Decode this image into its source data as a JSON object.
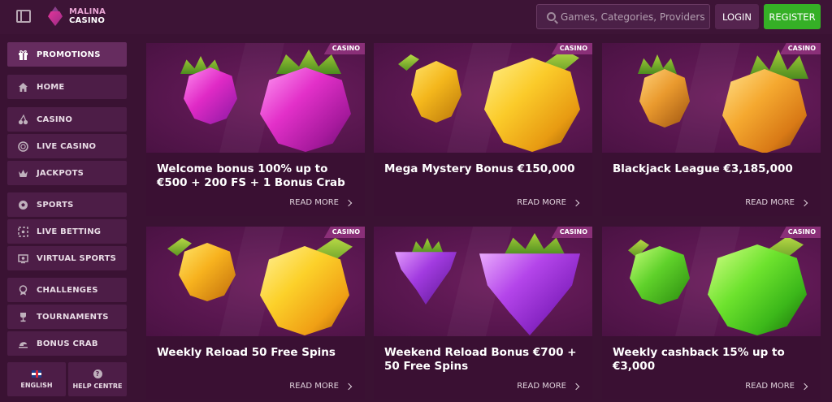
{
  "header": {
    "logo_line1": "MALINA",
    "logo_line2": "CASINO",
    "search_placeholder": "Games, Categories, Providers",
    "login_label": "LOGIN",
    "register_label": "REGISTER"
  },
  "sidebar": {
    "items": [
      {
        "label": "PROMOTIONS",
        "icon": "gift-icon"
      },
      {
        "label": "HOME",
        "icon": "home-icon"
      },
      {
        "label": "CASINO",
        "icon": "cherries-icon"
      },
      {
        "label": "LIVE CASINO",
        "icon": "chip-icon"
      },
      {
        "label": "JACKPOTS",
        "icon": "crown-icon"
      },
      {
        "label": "SPORTS",
        "icon": "ball-icon"
      },
      {
        "label": "LIVE BETTING",
        "icon": "live-icon"
      },
      {
        "label": "VIRTUAL SPORTS",
        "icon": "screen-icon"
      },
      {
        "label": "CHALLENGES",
        "icon": "badge-icon"
      },
      {
        "label": "TOURNAMENTS",
        "icon": "trophy-icon"
      },
      {
        "label": "BONUS CRAB",
        "icon": "crab-icon"
      }
    ],
    "language_label": "ENGLISH",
    "help_label": "HELP CENTRE"
  },
  "colors": {
    "background": "#3a1233",
    "register_green": "#35b026",
    "badge_purple": "#8a2f78"
  },
  "cards": [
    {
      "badge": "CASINO",
      "title": "Welcome bonus 100% up to €500 + 200 FS + 1 Bonus Crab",
      "read_more": "READ MORE",
      "fruit": "raspberry"
    },
    {
      "badge": "CASINO",
      "title": "Mega Mystery Bonus €150,000",
      "read_more": "READ MORE",
      "fruit": "pear"
    },
    {
      "badge": "CASINO",
      "title": "Blackjack League €3,185,000",
      "read_more": "READ MORE",
      "fruit": "pineapple"
    },
    {
      "badge": "CASINO",
      "title": "Weekly Reload 50 Free Spins",
      "read_more": "READ MORE",
      "fruit": "lemon"
    },
    {
      "badge": "CASINO",
      "title": "Weekend Reload Bonus €700 + 50 Free Spins",
      "read_more": "READ MORE",
      "fruit": "grapes"
    },
    {
      "badge": "CASINO",
      "title": "Weekly cashback 15% up to €3,000",
      "read_more": "READ MORE",
      "fruit": "apple"
    }
  ]
}
